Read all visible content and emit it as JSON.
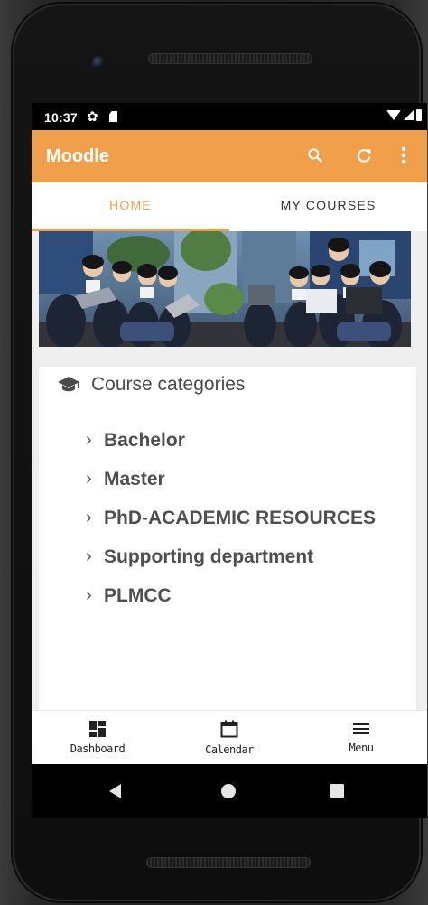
{
  "statusbar": {
    "time": "10:37"
  },
  "appbar": {
    "title": "Moodle",
    "color": "#f0a04b"
  },
  "tabs": [
    {
      "label": "HOME",
      "active": true
    },
    {
      "label": "MY COURSES",
      "active": false
    }
  ],
  "banner": {
    "icon": "students-photo"
  },
  "courses": {
    "title": "Course categories",
    "icon": "graduation-cap-icon",
    "items": [
      {
        "label": "Bachelor"
      },
      {
        "label": "Master"
      },
      {
        "label": "PhD-ACADEMIC RESOURCES"
      },
      {
        "label": "Supporting department"
      },
      {
        "label": "PLMCC"
      }
    ]
  },
  "bottomnav": [
    {
      "label": "Dashboard",
      "icon": "dashboard-icon"
    },
    {
      "label": "Calendar",
      "icon": "calendar-icon"
    },
    {
      "label": "Menu",
      "icon": "menu-icon"
    }
  ],
  "sysnav": {
    "icons": [
      "back-icon",
      "home-icon",
      "recents-icon"
    ]
  }
}
